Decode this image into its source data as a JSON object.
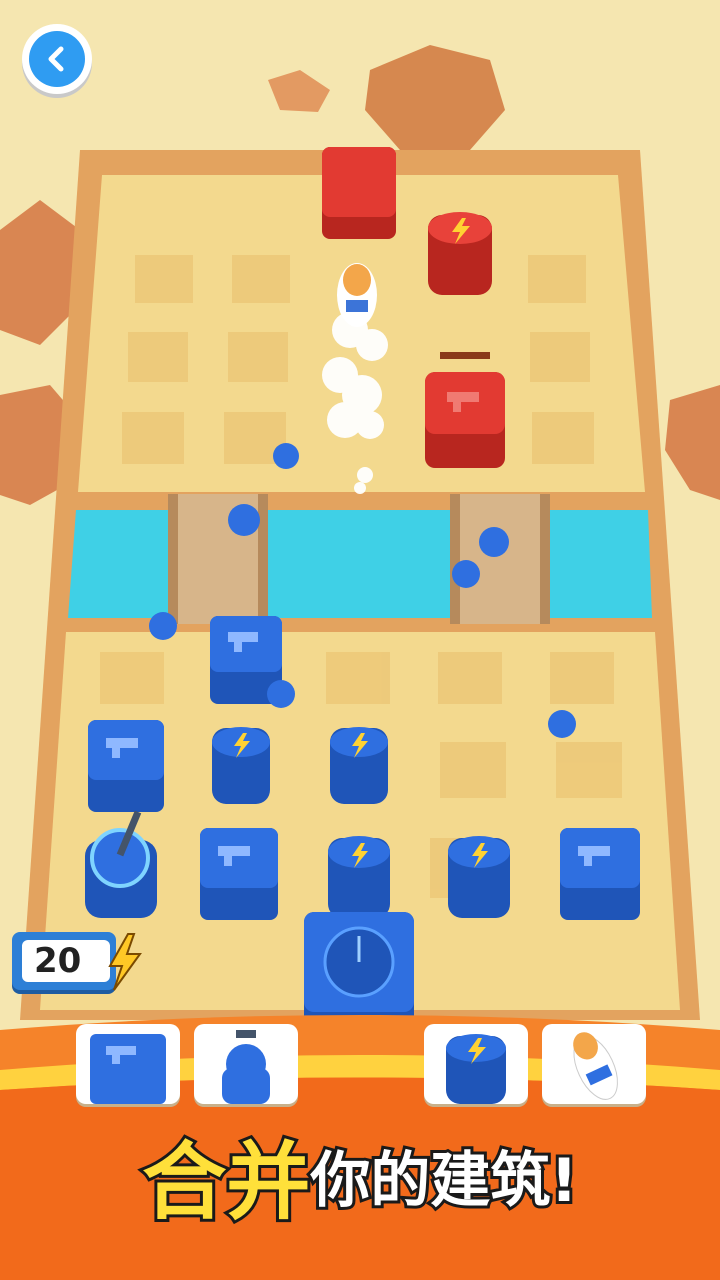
{
  "hud": {
    "back_icon": "chevron-left-icon",
    "energy_value": "20",
    "energy_icon": "lightning-icon"
  },
  "shop": {
    "cards": [
      {
        "name": "shop-card-gun-block",
        "icon": "gun-icon"
      },
      {
        "name": "shop-card-soldier",
        "icon": "soldier-icon"
      },
      {
        "name": "shop-card-energy",
        "icon": "lightning-icon"
      },
      {
        "name": "shop-card-rocket",
        "icon": "rocket-icon"
      }
    ]
  },
  "banner": {
    "char1": "合",
    "char2": "并",
    "rest": "你的建筑!"
  },
  "colors": {
    "player": "#2f6fe0",
    "enemy": "#e23a32",
    "water": "#3fd0e6",
    "sand": "#f3d98e",
    "frame": "#e3a35f",
    "banner_orange": "#f5832a",
    "title_yellow": "#ffe03a"
  }
}
